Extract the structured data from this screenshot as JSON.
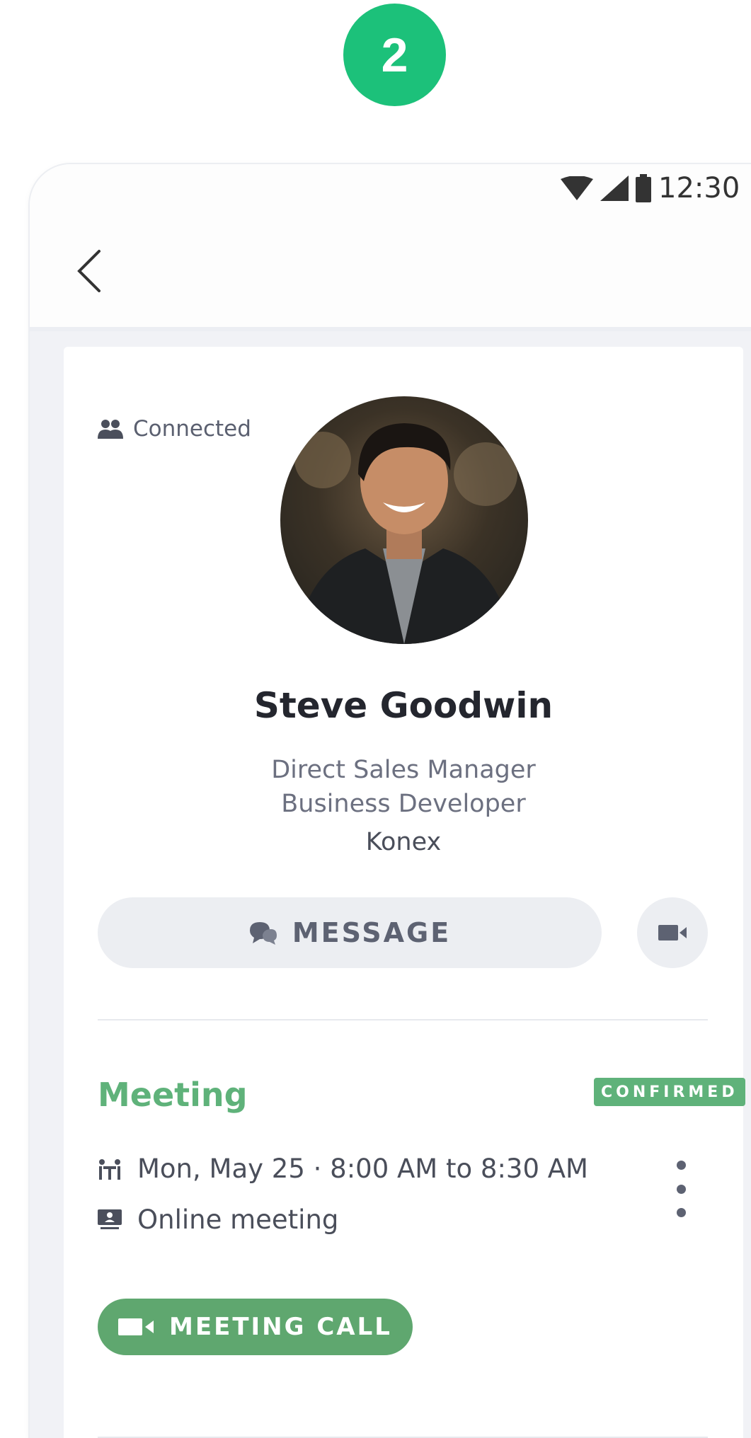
{
  "step": {
    "number": "2"
  },
  "status_bar": {
    "time": "12:30"
  },
  "profile": {
    "connection_status": "Connected",
    "name": "Steve Goodwin",
    "title_line1": "Direct Sales Manager",
    "title_line2": "Business Developer",
    "company": "Konex"
  },
  "actions": {
    "message_label": "MESSAGE"
  },
  "meeting": {
    "heading": "Meeting",
    "badge": "CONFIRMED",
    "datetime": "Mon, May 25 · 8:00 AM to 8:30 AM",
    "location": "Online meeting",
    "call_label": "MEETING CALL"
  },
  "colors": {
    "step_badge": "#1cc17a",
    "meeting_accent": "#5fb27a",
    "call_button": "#5fa76f",
    "button_bg": "#eceef2"
  }
}
